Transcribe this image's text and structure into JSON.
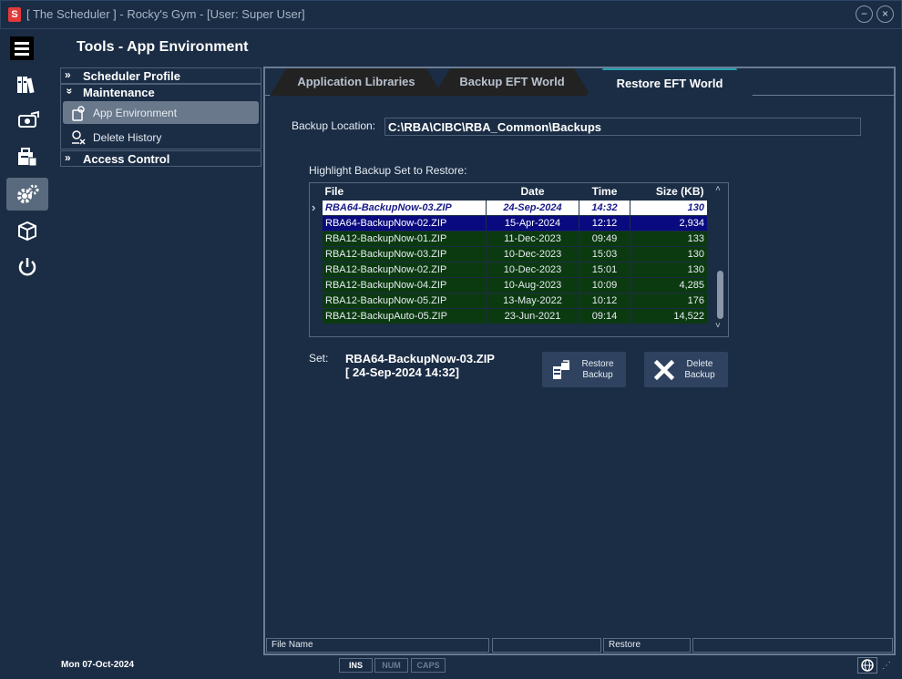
{
  "window": {
    "logo_letter": "S",
    "title": "[ The Scheduler ] - Rocky's Gym - [User: Super User]",
    "minimize_glyph": "−",
    "close_glyph": "×"
  },
  "page_title": "Tools - App Environment",
  "tree": {
    "expand_glyph": "»",
    "collapse_glyph": "≫",
    "sections": [
      {
        "label": "Scheduler Profile"
      },
      {
        "label": "Maintenance"
      },
      {
        "label": "Access Control"
      }
    ],
    "items": [
      {
        "label": "App Environment"
      },
      {
        "label": "Delete History"
      }
    ]
  },
  "tabs": [
    {
      "label": "Application Libraries"
    },
    {
      "label": "Backup EFT World"
    },
    {
      "label": "Restore EFT World"
    }
  ],
  "backup_location": {
    "label": "Backup Location:",
    "value": "C:\\RBA\\CIBC\\RBA_Common\\Backups"
  },
  "highlight_label": "Highlight Backup Set to Restore:",
  "grid": {
    "columns": [
      "File",
      "Date",
      "Time",
      "Size (KB)"
    ],
    "row_marker": "›",
    "rows": [
      {
        "file": "RBA64-BackupNow-03.ZIP",
        "date": "24-Sep-2024",
        "time": "14:32",
        "size": "130"
      },
      {
        "file": "RBA64-BackupNow-02.ZIP",
        "date": "15-Apr-2024",
        "time": "12:12",
        "size": "2,934"
      },
      {
        "file": "RBA12-BackupNow-01.ZIP",
        "date": "11-Dec-2023",
        "time": "09:49",
        "size": "133"
      },
      {
        "file": "RBA12-BackupNow-03.ZIP",
        "date": "10-Dec-2023",
        "time": "15:03",
        "size": "130"
      },
      {
        "file": "RBA12-BackupNow-02.ZIP",
        "date": "10-Dec-2023",
        "time": "15:01",
        "size": "130"
      },
      {
        "file": "RBA12-BackupNow-04.ZIP",
        "date": "10-Aug-2023",
        "time": "10:09",
        "size": "4,285"
      },
      {
        "file": "RBA12-BackupNow-05.ZIP",
        "date": "13-May-2022",
        "time": "10:12",
        "size": "176"
      },
      {
        "file": "RBA12-BackupAuto-05.ZIP",
        "date": "23-Jun-2021",
        "time": "09:14",
        "size": "14,522"
      }
    ],
    "scroll_up": "˄",
    "scroll_down": "˅"
  },
  "set": {
    "label": "Set:",
    "name": "RBA64-BackupNow-03.ZIP",
    "date": "[ 24-Sep-2024 14:32]"
  },
  "buttons": {
    "restore": {
      "line1": "Restore",
      "line2": "Backup"
    },
    "delete": {
      "line1": "Delete",
      "line2": "Backup"
    }
  },
  "status": {
    "file_name": "File Name",
    "mode": "Restore",
    "date": "Mon  07-Oct-2024",
    "ins": "INS",
    "num": "NUM",
    "caps": "CAPS",
    "grip": "⋰"
  },
  "colors": {
    "background": "#1b2d45",
    "accent_tab": "#23a0b0",
    "selected_row": "#0a0a80",
    "row_green": "#0c3a10",
    "logo_red": "#e23a3a"
  },
  "icons": [
    "hamburger-icon",
    "libraries-icon",
    "money-icon",
    "reports-icon",
    "gears-icon",
    "box-icon",
    "power-icon",
    "app-env-icon",
    "delete-history-icon",
    "restore-icon",
    "delete-x-icon",
    "globe-icon"
  ]
}
